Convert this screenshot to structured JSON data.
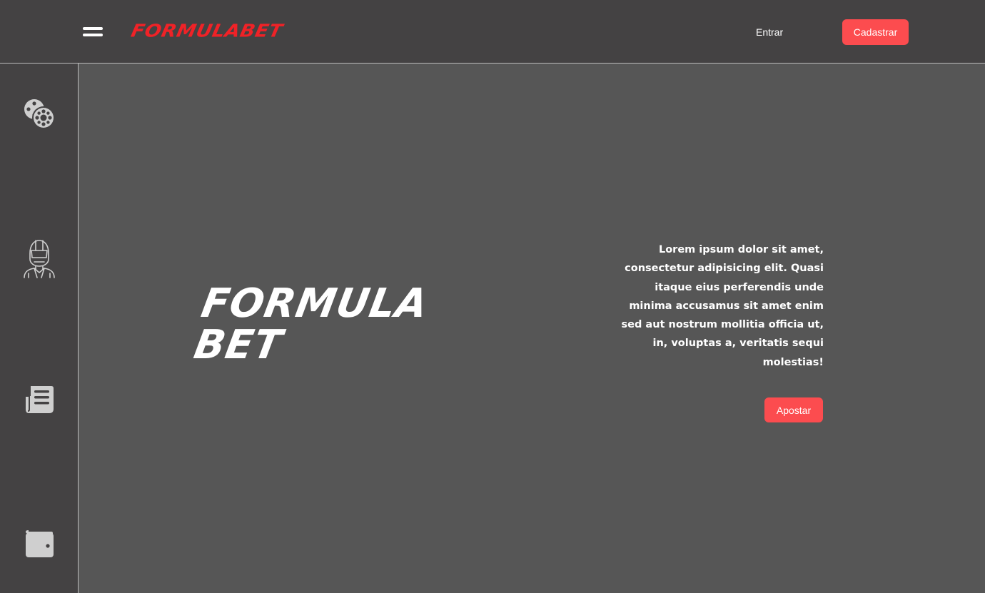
{
  "header": {
    "logo_text": "FORMULABET",
    "login_label": "Entrar",
    "signup_label": "Cadastrar"
  },
  "sidebar": {
    "items": [
      {
        "icon": "film-reels-icon"
      },
      {
        "icon": "racing-driver-icon"
      },
      {
        "icon": "newspaper-icon"
      },
      {
        "icon": "wallet-icon"
      }
    ]
  },
  "hero": {
    "title_line1": "FORMULA",
    "title_line2": "BET",
    "description": "Lorem ipsum dolor sit amet, consectetur adipisicing elit. Quasi itaque eius perferendis unde minima accusamus sit amet enim sed aut nostrum mollitia officia ut, in, voluptas a, veritatis sequi molestias!",
    "cta_label": "Apostar"
  },
  "colors": {
    "header_bg": "#444243",
    "main_bg": "#565656",
    "accent": "#fc4c4f",
    "logo_red": "#f02227",
    "icon_gray": "#d0d0d0"
  }
}
